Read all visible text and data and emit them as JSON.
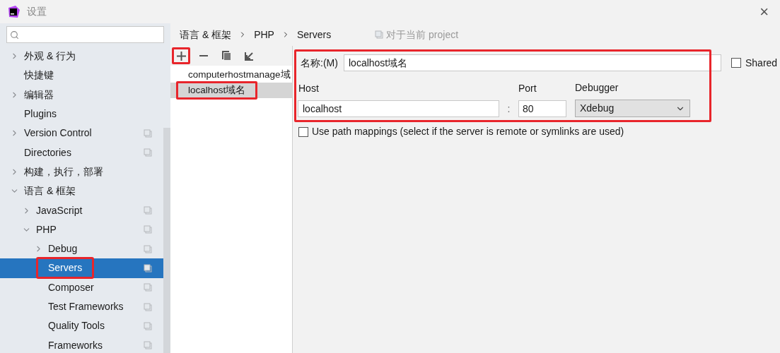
{
  "window": {
    "title": "设置",
    "close": "×"
  },
  "sidebar": {
    "items": [
      {
        "label": "外观 & 行为",
        "kind": "folder",
        "expanded": false,
        "project_scope": false,
        "selected": false,
        "highlighted": false
      },
      {
        "label": "快捷键",
        "kind": "page",
        "project_scope": false,
        "selected": false,
        "highlighted": false
      },
      {
        "label": "编辑器",
        "kind": "folder",
        "expanded": false,
        "project_scope": false,
        "selected": false,
        "highlighted": false
      },
      {
        "label": "Plugins",
        "kind": "page",
        "project_scope": false,
        "selected": false,
        "highlighted": false
      },
      {
        "label": "Version Control",
        "kind": "folder",
        "expanded": false,
        "project_scope": true,
        "selected": false,
        "highlighted": false
      },
      {
        "label": "Directories",
        "kind": "page",
        "project_scope": true,
        "selected": false,
        "highlighted": false
      },
      {
        "label": "构建，执行，部署",
        "kind": "folder",
        "expanded": false,
        "project_scope": false,
        "selected": false,
        "highlighted": false
      },
      {
        "label": "语言 & 框架",
        "kind": "folder",
        "expanded": true,
        "project_scope": false,
        "selected": false,
        "highlighted": false,
        "children": [
          {
            "label": "JavaScript",
            "kind": "folder",
            "expanded": false,
            "project_scope": true,
            "selected": false,
            "highlighted": false
          },
          {
            "label": "PHP",
            "kind": "folder",
            "expanded": true,
            "project_scope": true,
            "selected": false,
            "highlighted": false,
            "children": [
              {
                "label": "Debug",
                "kind": "folder",
                "expanded": false,
                "project_scope": true,
                "selected": false,
                "highlighted": false
              },
              {
                "label": "Servers",
                "kind": "page",
                "project_scope": true,
                "selected": true,
                "highlighted": true
              },
              {
                "label": "Composer",
                "kind": "page",
                "project_scope": true,
                "selected": false,
                "highlighted": false
              },
              {
                "label": "Test Frameworks",
                "kind": "page",
                "project_scope": true,
                "selected": false,
                "highlighted": false
              },
              {
                "label": "Quality Tools",
                "kind": "page",
                "project_scope": true,
                "selected": false,
                "highlighted": false
              },
              {
                "label": "Frameworks",
                "kind": "page",
                "project_scope": true,
                "selected": false,
                "highlighted": false
              }
            ]
          }
        ]
      }
    ]
  },
  "breadcrumb": [
    "语言 & 框架",
    "PHP",
    "Servers"
  ],
  "scope_note": "对于当前 project",
  "toolbar": [
    {
      "kind": "add",
      "highlighted": true
    },
    {
      "kind": "remove",
      "highlighted": false
    },
    {
      "kind": "copy",
      "highlighted": false
    },
    {
      "kind": "import",
      "highlighted": false
    }
  ],
  "servers": [
    {
      "label": "computerhostmanage域",
      "selected": false,
      "highlighted": false
    },
    {
      "label": "localhost域名",
      "selected": true,
      "highlighted": true
    }
  ],
  "form": {
    "highlighted": true,
    "name_label": "名称:(M)",
    "name_value": "localhost域名",
    "shared": {
      "label": "Shared",
      "checked": false
    },
    "host_label": "Host",
    "host_value": "localhost",
    "separator": ":",
    "port_label": "Port",
    "port_value": "80",
    "debugger_label": "Debugger",
    "debugger_value": "Xdebug",
    "path_mappings": {
      "label": "Use path mappings (select if the server is remote or symlinks are used)",
      "checked": false
    }
  }
}
